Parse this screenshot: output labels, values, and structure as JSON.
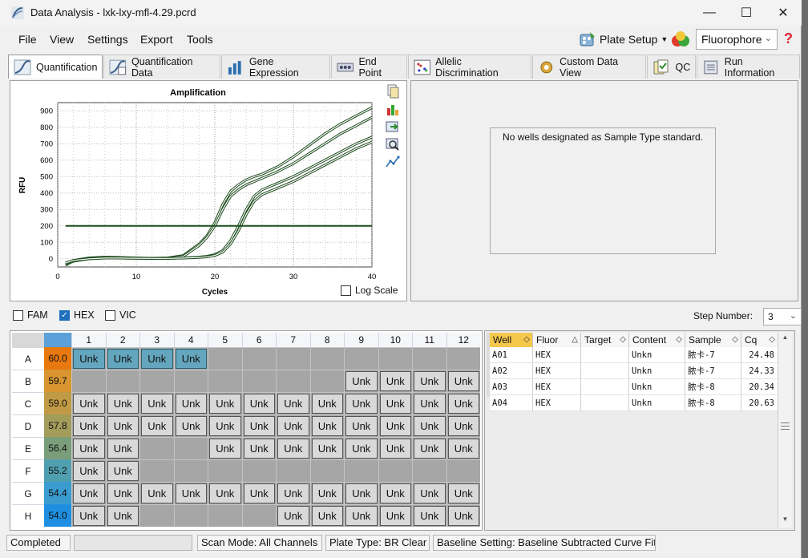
{
  "window": {
    "title": "Data Analysis - lxk-lxy-mfl-4.29.pcrd"
  },
  "menu": {
    "items": [
      "File",
      "View",
      "Settings",
      "Export",
      "Tools"
    ]
  },
  "toolbar": {
    "plate_setup_label": "Plate Setup",
    "fluorophore_value": "Fluorophore",
    "help_label": "?"
  },
  "tabs": [
    "Quantification",
    "Quantification Data",
    "Gene Expression",
    "End Point",
    "Allelic Discrimination",
    "Custom Data View",
    "QC",
    "Run Information"
  ],
  "chart_data": {
    "type": "line",
    "title": "Amplification",
    "xlabel": "Cycles",
    "ylabel": "RFU",
    "xlim": [
      0,
      40
    ],
    "ylim": [
      -50,
      950
    ],
    "xticks": [
      "0",
      "10",
      "20",
      "30",
      "40"
    ],
    "yticks": [
      "0",
      "100",
      "200",
      "300",
      "400",
      "500",
      "600",
      "700",
      "800",
      "900"
    ],
    "threshold": 200,
    "x": [
      1,
      2,
      4,
      6,
      8,
      10,
      12,
      14,
      16,
      18,
      19,
      20,
      21,
      22,
      23,
      24,
      25,
      26,
      28,
      30,
      32,
      34,
      36,
      38,
      40
    ],
    "series": [
      {
        "values": [
          -40,
          -10,
          5,
          10,
          8,
          5,
          3,
          5,
          20,
          90,
          140,
          220,
          330,
          410,
          450,
          480,
          500,
          515,
          560,
          620,
          690,
          760,
          820,
          870,
          920
        ]
      },
      {
        "values": [
          -35,
          -15,
          5,
          8,
          6,
          4,
          2,
          4,
          15,
          80,
          130,
          200,
          300,
          380,
          420,
          450,
          470,
          490,
          530,
          580,
          640,
          700,
          760,
          810,
          860
        ]
      },
      {
        "values": [
          -30,
          -15,
          0,
          5,
          4,
          3,
          2,
          2,
          5,
          10,
          15,
          25,
          50,
          110,
          200,
          300,
          380,
          420,
          460,
          500,
          550,
          600,
          650,
          700,
          740
        ]
      },
      {
        "values": [
          -25,
          -10,
          0,
          4,
          4,
          3,
          2,
          2,
          4,
          8,
          12,
          20,
          40,
          90,
          170,
          270,
          350,
          390,
          430,
          470,
          520,
          570,
          620,
          670,
          710
        ]
      }
    ],
    "log_scale_label": "Log Scale"
  },
  "right_panel": {
    "message": "No wells designated as Sample Type standard."
  },
  "dyes": [
    {
      "label": "FAM",
      "checked": false
    },
    {
      "label": "HEX",
      "checked": true
    },
    {
      "label": "VIC",
      "checked": false
    }
  ],
  "step": {
    "label": "Step Number:",
    "value": "3"
  },
  "plate": {
    "columns": [
      "1",
      "2",
      "3",
      "4",
      "5",
      "6",
      "7",
      "8",
      "9",
      "10",
      "11",
      "12"
    ],
    "rows": [
      {
        "label": "A",
        "temp": "60.0",
        "color": "#e8780e",
        "wells": [
          "Unk",
          "Unk",
          "Unk",
          "Unk",
          "",
          "",
          "",
          "",
          "",
          "",
          "",
          ""
        ],
        "selected": [
          0,
          1,
          2,
          3
        ]
      },
      {
        "label": "B",
        "temp": "59.7",
        "color": "#d89530",
        "wells": [
          "",
          "",
          "",
          "",
          "",
          "",
          "",
          "",
          "Unk",
          "Unk",
          "Unk",
          "Unk"
        ],
        "selected": []
      },
      {
        "label": "C",
        "temp": "59.0",
        "color": "#c09a45",
        "wells": [
          "Unk",
          "Unk",
          "Unk",
          "Unk",
          "Unk",
          "Unk",
          "Unk",
          "Unk",
          "Unk",
          "Unk",
          "Unk",
          "Unk"
        ],
        "selected": []
      },
      {
        "label": "D",
        "temp": "57.8",
        "color": "#a39c5a",
        "wells": [
          "Unk",
          "Unk",
          "Unk",
          "Unk",
          "Unk",
          "Unk",
          "Unk",
          "Unk",
          "Unk",
          "Unk",
          "Unk",
          "Unk"
        ],
        "selected": []
      },
      {
        "label": "E",
        "temp": "56.4",
        "color": "#7b9e7a",
        "wells": [
          "Unk",
          "Unk",
          "",
          "",
          "Unk",
          "Unk",
          "Unk",
          "Unk",
          "Unk",
          "Unk",
          "Unk",
          "Unk"
        ],
        "selected": []
      },
      {
        "label": "F",
        "temp": "55.2",
        "color": "#4f9fb0",
        "wells": [
          "Unk",
          "Unk",
          "",
          "",
          "",
          "",
          "",
          "",
          "",
          "",
          "",
          ""
        ],
        "selected": []
      },
      {
        "label": "G",
        "temp": "54.4",
        "color": "#3a9bd0",
        "wells": [
          "Unk",
          "Unk",
          "Unk",
          "Unk",
          "Unk",
          "Unk",
          "Unk",
          "Unk",
          "Unk",
          "Unk",
          "Unk",
          "Unk"
        ],
        "selected": []
      },
      {
        "label": "H",
        "temp": "54.0",
        "color": "#1e8fe0",
        "wells": [
          "Unk",
          "Unk",
          "",
          "",
          "",
          "",
          "Unk",
          "Unk",
          "Unk",
          "Unk",
          "Unk",
          "Unk"
        ],
        "selected": []
      }
    ]
  },
  "results_table": {
    "headers": [
      "Well",
      "Fluor",
      "Target",
      "Content",
      "Sample",
      "Cq"
    ],
    "rows": [
      [
        "A01",
        "HEX",
        "",
        "Unkn",
        "脓卡-7",
        "24.48"
      ],
      [
        "A02",
        "HEX",
        "",
        "Unkn",
        "脓卡-7",
        "24.33"
      ],
      [
        "A03",
        "HEX",
        "",
        "Unkn",
        "脓卡-8",
        "20.34"
      ],
      [
        "A04",
        "HEX",
        "",
        "Unkn",
        "脓卡-8",
        "20.63"
      ]
    ]
  },
  "status": [
    "Completed",
    "",
    "Scan Mode: All Channels",
    "Plate Type: BR Clear",
    "Baseline Setting: Baseline Subtracted Curve Fit"
  ]
}
